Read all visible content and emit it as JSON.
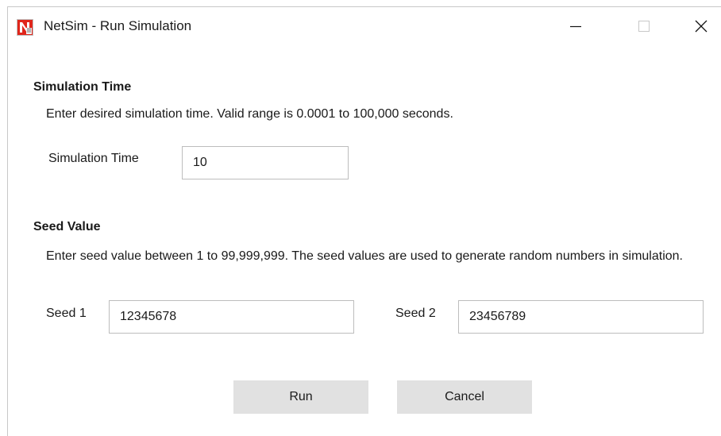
{
  "window": {
    "title": "NetSim - Run Simulation"
  },
  "simulation_time": {
    "heading": "Simulation Time",
    "description": "Enter desired simulation time. Valid range is 0.0001 to 100,000 seconds.",
    "label": "Simulation Time",
    "value": "10"
  },
  "seed": {
    "heading": "Seed Value",
    "description": "Enter seed value between 1 to 99,999,999. The seed values are used to generate random numbers in simulation.",
    "seed1_label": "Seed 1",
    "seed1_value": "12345678",
    "seed2_label": "Seed 2",
    "seed2_value": "23456789"
  },
  "buttons": {
    "run": "Run",
    "cancel": "Cancel"
  },
  "colors": {
    "icon_red": "#e0261b",
    "button_bg": "#e1e1e1",
    "field_border": "#bdbdbd"
  },
  "icons": {
    "app": "netsim-logo-icon",
    "minimize": "minimize-icon",
    "maximize": "maximize-icon",
    "close": "close-icon"
  }
}
